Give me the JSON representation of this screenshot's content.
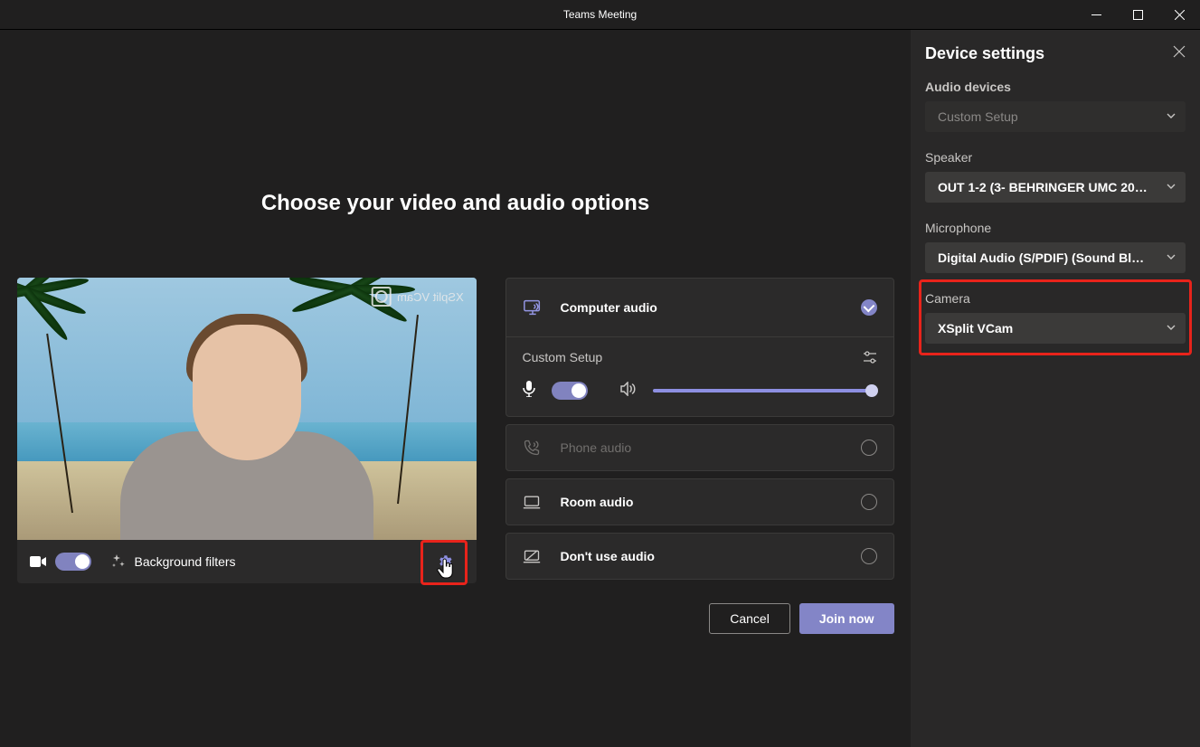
{
  "window": {
    "title": "Teams Meeting"
  },
  "main": {
    "heading": "Choose your video and audio options",
    "video": {
      "watermark_text": "XSplit VCam",
      "background_filters_label": "Background filters"
    },
    "audio_options": {
      "computer_audio": "Computer audio",
      "custom_setup": "Custom Setup",
      "phone_audio": "Phone audio",
      "room_audio": "Room audio",
      "dont_use_audio": "Don't use audio"
    },
    "actions": {
      "cancel": "Cancel",
      "join": "Join now"
    }
  },
  "settings_panel": {
    "title": "Device settings",
    "audio_devices": {
      "label": "Audio devices",
      "value": "Custom Setup"
    },
    "speaker": {
      "label": "Speaker",
      "value": "OUT 1-2 (3- BEHRINGER UMC 20…"
    },
    "microphone": {
      "label": "Microphone",
      "value": "Digital Audio (S/PDIF) (Sound Bl…"
    },
    "camera": {
      "label": "Camera",
      "value": "XSplit VCam"
    }
  }
}
